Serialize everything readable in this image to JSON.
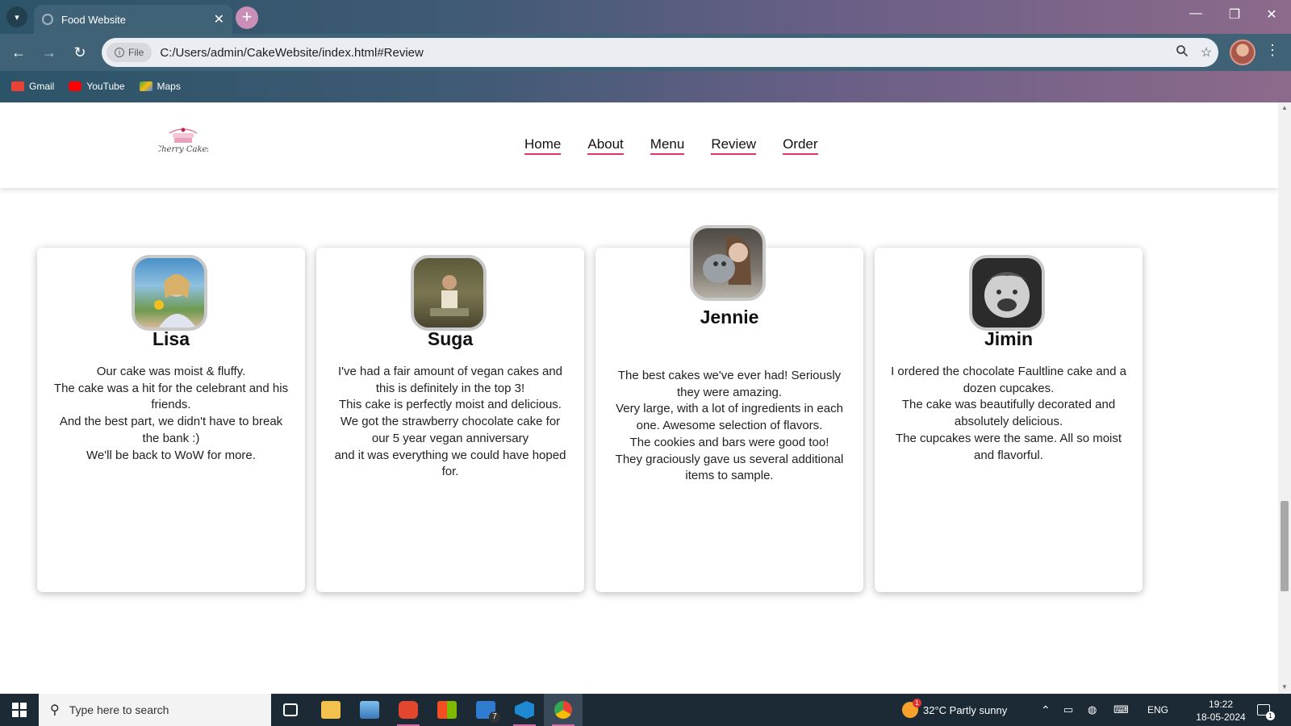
{
  "browser": {
    "tab_title": "Food Website",
    "address_chip": "File",
    "url": "C:/Users/admin/CakeWebsite/index.html#Review",
    "bookmarks": [
      {
        "label": "Gmail",
        "color": "#ea4335"
      },
      {
        "label": "YouTube",
        "color": "#ff0000"
      },
      {
        "label": "Maps",
        "color": "#34a853"
      }
    ]
  },
  "site": {
    "logo_text": "Cherry Cakes",
    "nav": [
      "Home",
      "About",
      "Menu",
      "Review",
      "Order"
    ],
    "accent_color": "#e2356a"
  },
  "reviews": [
    {
      "name": "Lisa",
      "lines": [
        "Our cake was moist & fluffy.",
        "The cake was a hit for the celebrant and his friends.",
        "And the best part, we didn't have to break the bank :)",
        "We'll be back to WoW for more."
      ]
    },
    {
      "name": "Suga",
      "lines": [
        "I've had a fair amount of vegan cakes and this is definitely in the top 3!",
        "This cake is perfectly moist and delicious.",
        "We got the strawberry chocolate cake for our 5 year vegan anniversary",
        "and it was everything we could have hoped for."
      ]
    },
    {
      "name": "Jennie",
      "lines": [
        "The best cakes we've ever had! Seriously they were amazing.",
        "Very large, with a lot of ingredients in each one. Awesome selection of flavors.",
        "The cookies and bars were good too!",
        "They graciously gave us several additional items to sample."
      ]
    },
    {
      "name": "Jimin",
      "lines": [
        "I ordered the chocolate Faultline cake and a dozen cupcakes.",
        "The cake was beautifully decorated and absolutely delicious.",
        "The cupcakes were the same. All so moist and flavorful."
      ]
    }
  ],
  "taskbar": {
    "search_placeholder": "Type here to search",
    "mail_badge": "7",
    "weather": "32°C  Partly sunny",
    "weather_badge": "1",
    "language": "ENG",
    "time": "19:22",
    "date": "18-05-2024",
    "notification_badge": "1"
  }
}
